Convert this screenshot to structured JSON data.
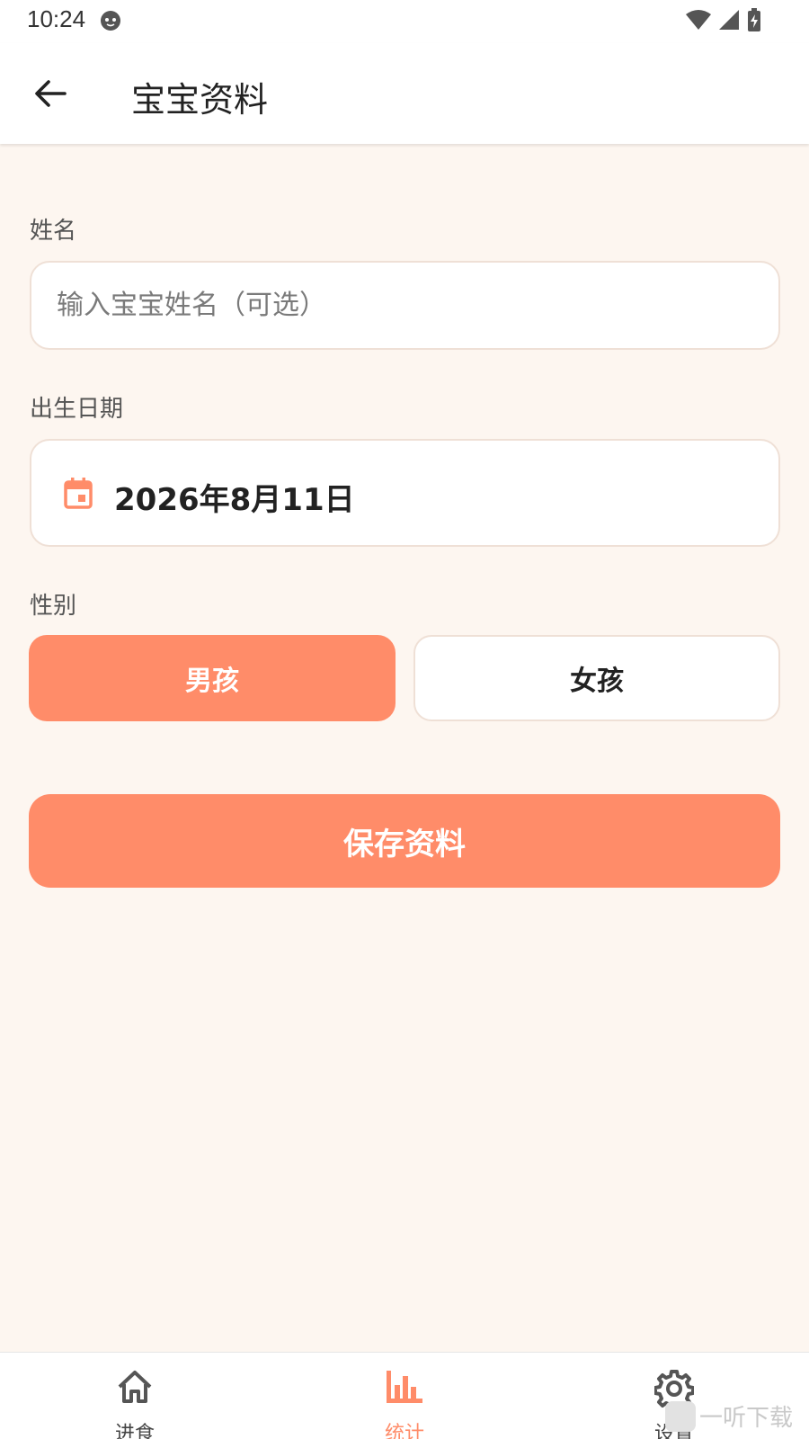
{
  "status_bar": {
    "time": "10:24"
  },
  "app_bar": {
    "title": "宝宝资料"
  },
  "form": {
    "name_label": "姓名",
    "name_placeholder": "输入宝宝姓名（可选）",
    "name_value": "",
    "birth_label": "出生日期",
    "birth_value": "2026年8月11日",
    "gender_label": "性别",
    "gender_options": [
      "男孩",
      "女孩"
    ],
    "gender_selected": "男孩",
    "save_label": "保存资料"
  },
  "bottom_nav": {
    "items": [
      {
        "label": "进食",
        "icon": "home-icon",
        "active": false
      },
      {
        "label": "统计",
        "icon": "bar-chart-icon",
        "active": true
      },
      {
        "label": "设置",
        "icon": "gear-icon",
        "active": false
      }
    ]
  },
  "watermark": {
    "text": "一听下载"
  },
  "colors": {
    "accent": "#FF8C69",
    "background": "#FDF6F0",
    "border": "#EFE0D6"
  }
}
